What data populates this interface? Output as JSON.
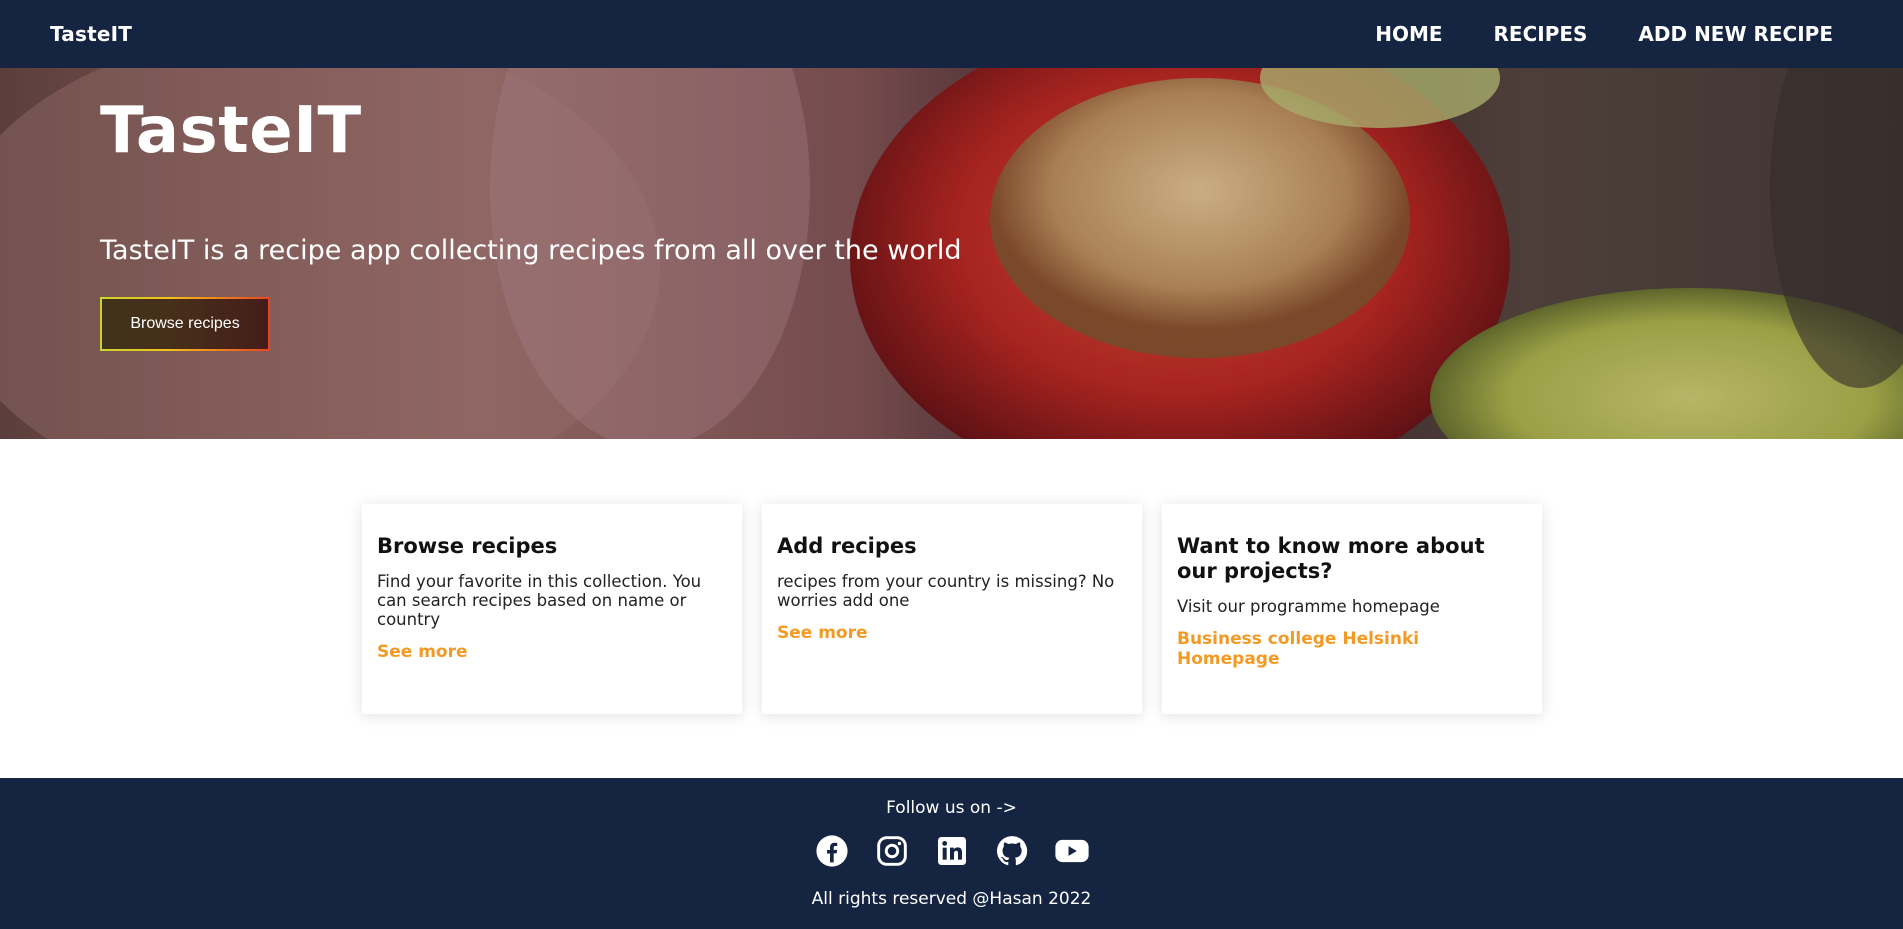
{
  "header": {
    "brand": "TasteIT",
    "nav": [
      "HOME",
      "RECIPES",
      "ADD NEW RECIPE"
    ]
  },
  "hero": {
    "title": "TasteIT",
    "subtitle": "TasteIT is a recipe app collecting recipes from all over the world",
    "button_label": "Browse recipes"
  },
  "cards": [
    {
      "title": "Browse recipes",
      "text": "Find your favorite in this collection. You can search recipes based on name or country",
      "link": "See more"
    },
    {
      "title": "Add recipes",
      "text": "recipes from your country is missing? No worries add one",
      "link": "See more"
    },
    {
      "title": "Want to know more about our projects?",
      "text": "Visit our programme homepage",
      "link": "Business college Helsinki Homepage"
    }
  ],
  "footer": {
    "follow": "Follow us on ->",
    "socials": [
      "facebook-icon",
      "instagram-icon",
      "linkedin-icon",
      "github-icon",
      "youtube-icon"
    ],
    "copyright": "All rights reserved @Hasan 2022"
  },
  "colors": {
    "navy": "#142441",
    "accent": "#f39a24"
  }
}
